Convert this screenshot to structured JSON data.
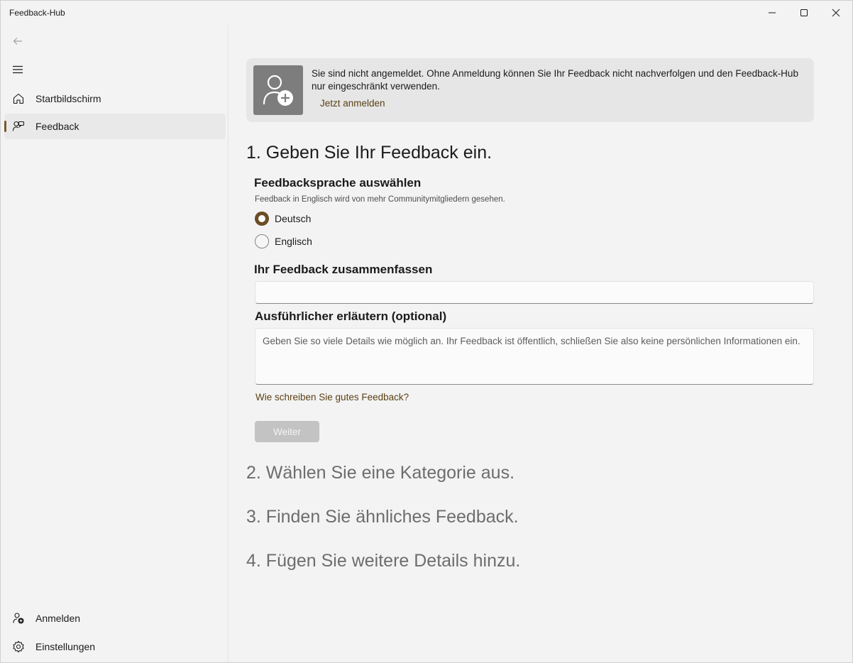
{
  "window": {
    "title": "Feedback-Hub"
  },
  "sidebar": {
    "items": [
      {
        "label": "Startbildschirm",
        "icon": "home-icon"
      },
      {
        "label": "Feedback",
        "icon": "feedback-icon",
        "selected": true
      }
    ],
    "footer": [
      {
        "label": "Anmelden",
        "icon": "person-add-icon"
      },
      {
        "label": "Einstellungen",
        "icon": "gear-icon"
      }
    ]
  },
  "banner": {
    "message": "Sie sind nicht angemeldet. Ohne Anmeldung können Sie Ihr Feedback nicht nachverfolgen und den Feedback-Hub nur eingeschränkt verwenden.",
    "link": "Jetzt anmelden"
  },
  "steps": [
    "1. Geben Sie Ihr Feedback ein.",
    "2. Wählen Sie eine Kategorie aus.",
    "3. Finden Sie ähnliches Feedback.",
    "4. Fügen Sie weitere Details hinzu."
  ],
  "form": {
    "language_heading": "Feedbacksprache auswählen",
    "language_hint": "Feedback in Englisch wird von mehr Communitymitgliedern gesehen.",
    "languages": [
      {
        "label": "Deutsch",
        "checked": true
      },
      {
        "label": "Englisch",
        "checked": false
      }
    ],
    "summary_heading": "Ihr Feedback zusammenfassen",
    "summary_value": "",
    "details_heading": "Ausführlicher erläutern (optional)",
    "details_placeholder": "Geben Sie so viele Details wie möglich an. Ihr Feedback ist öffentlich, schließen Sie also keine persönlichen Informationen ein.",
    "help_link": "Wie schreiben Sie gutes Feedback?",
    "next_label": "Weiter"
  },
  "colors": {
    "accent": "#6b4c24",
    "link": "#5b3f14",
    "disabled_button": "#c3c3c3"
  }
}
